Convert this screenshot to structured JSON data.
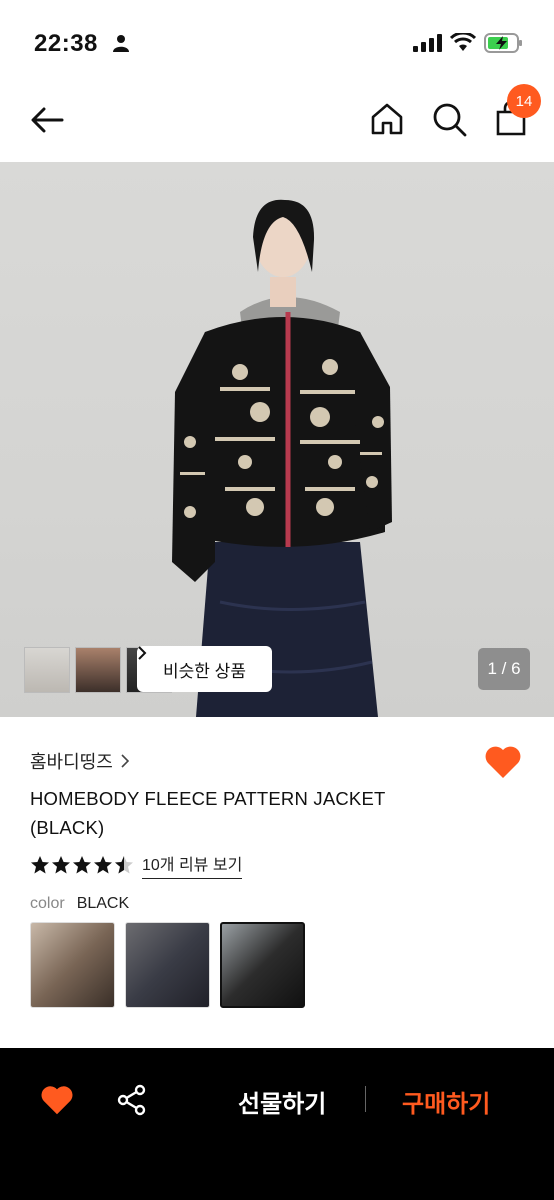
{
  "status_bar": {
    "time": "22:38"
  },
  "header": {
    "cart_count": "14"
  },
  "hero": {
    "similar_label": "비슷한 상품",
    "counter": "1 / 6"
  },
  "product": {
    "brand": "홈바디띵즈",
    "title": "HOMEBODY FLEECE PATTERN JACKET (BLACK)",
    "rating": 4.5,
    "review_link": "10개 리뷰 보기",
    "color_label": "color",
    "color_value": "BLACK"
  },
  "bottom_bar": {
    "gift_label": "선물하기",
    "buy_label": "구매하기"
  },
  "colors": {
    "accent": "#ff5a1f",
    "bar_bg": "#000000"
  }
}
